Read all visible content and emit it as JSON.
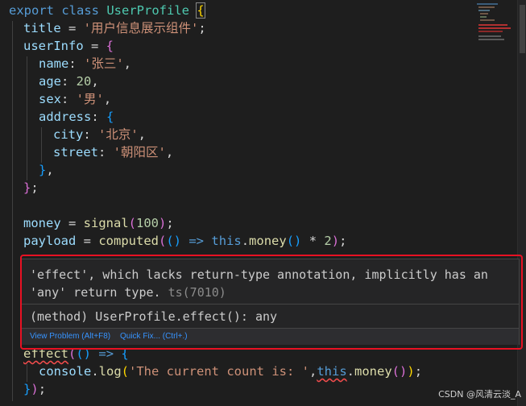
{
  "editor": {
    "lines": [
      [
        "export class UserProfile {"
      ],
      [
        "  title = '用户信息展示组件';"
      ],
      [
        "  userInfo = {"
      ],
      [
        "    name: '张三',"
      ],
      [
        "    age: 20,"
      ],
      [
        "    sex: '男',"
      ],
      [
        "    address: {"
      ],
      [
        "      city: '北京',"
      ],
      [
        "      street: '朝阳区',"
      ],
      [
        "    },"
      ],
      [
        "  };"
      ],
      [
        ""
      ],
      [
        "  money = signal(100);"
      ],
      [
        "  payload = computed(() => this.money() * 2);"
      ],
      [
        "  effect(() => {"
      ],
      [
        "    console.log('The current count is: ',this.money());"
      ],
      [
        "  });"
      ]
    ]
  },
  "hover": {
    "message": "'effect', which lacks return-type annotation, implicitly has an 'any' return type.",
    "source": " ts(7010)",
    "signature": "(method) UserProfile.effect(): any",
    "actions": {
      "view_problem": "View Problem (Alt+F8)",
      "quick_fix": "Quick Fix... (Ctrl+.)"
    }
  },
  "watermark": "CSDN @风清云淡_A",
  "colors": {
    "keyword": "#569cd6",
    "class": "#4ec9b0",
    "property": "#9cdcfe",
    "string": "#ce9178",
    "number": "#b5cea8",
    "function": "#dcdcaa",
    "error": "#f14c4c",
    "highlight_border": "#e81123",
    "link": "#3794ff"
  }
}
